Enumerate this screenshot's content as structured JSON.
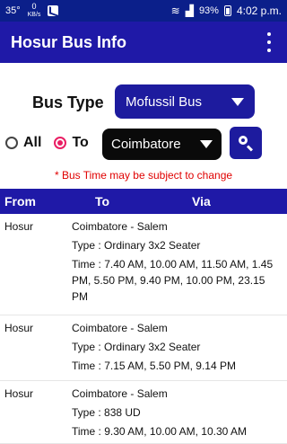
{
  "status_bar": {
    "temperature": "35°",
    "speed_value": "0",
    "speed_unit": "KB/s",
    "battery": "93%",
    "time": "4:02 p.m."
  },
  "app_bar": {
    "title": "Hosur Bus Info"
  },
  "controls": {
    "bus_type_label": "Bus Type",
    "bus_type_value": "Mofussil Bus",
    "radio_all_label": "All",
    "radio_to_label": "To",
    "selected_radio": "To",
    "destination_value": "Coimbatore",
    "notice": "* Bus Time may be subject to change"
  },
  "table": {
    "headers": {
      "from": "From",
      "to": "To",
      "via": "Via"
    },
    "rows": [
      {
        "from": "Hosur",
        "route": "Coimbatore  -  Salem",
        "type": "Type :  Ordinary 3x2 Seater",
        "time": "Time : 7.40 AM,  10.00 AM,  11.50 AM, 1.45 PM,  5.50 PM,  9.40 PM,  10.00 PM, 23.15 PM"
      },
      {
        "from": "Hosur",
        "route": "Coimbatore  -  Salem",
        "type": "Type :  Ordinary 3x2 Seater",
        "time": "Time : 7.15 AM,  5.50 PM,  9.14 PM"
      },
      {
        "from": "Hosur",
        "route": "Coimbatore  -  Salem",
        "type": "Type :  838 UD",
        "time": "Time : 9.30 AM,  10.00 AM,  10.30 AM"
      }
    ]
  },
  "colors": {
    "primary": "#1f19a7",
    "accent": "#e91e63",
    "notice": "#e00000"
  },
  "icons": [
    "wifi-icon",
    "signal-icon",
    "battery-icon",
    "more-vert-icon",
    "chevron-down-icon",
    "search-icon"
  ]
}
